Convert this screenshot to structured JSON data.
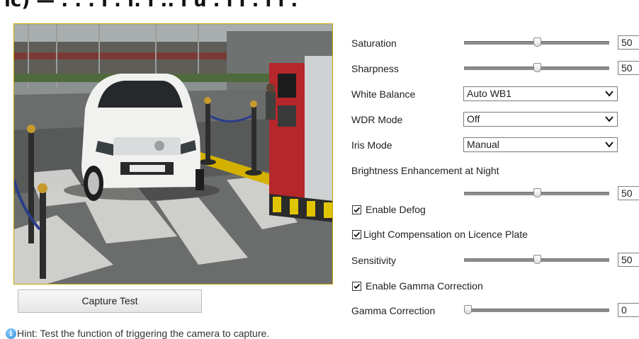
{
  "header_fragment": "ıc)  —  . . . ı . ı: ı .. ı  u .  ı  ı   .    ı ı  .",
  "preview": {
    "accent_border": "#c9a400"
  },
  "capture_test": {
    "label": "Capture Test"
  },
  "hint": {
    "icon": "info-icon",
    "text": "Hint: Test the function of triggering the camera to capture."
  },
  "settings": {
    "saturation": {
      "label": "Saturation",
      "value": "50",
      "level": 0.5
    },
    "sharpness": {
      "label": "Sharpness",
      "value": "50",
      "level": 0.5
    },
    "white_balance": {
      "label": "White Balance",
      "selected": "Auto WB1"
    },
    "wdr_mode": {
      "label": "WDR Mode",
      "selected": "Off"
    },
    "iris_mode": {
      "label": "Iris Mode",
      "selected": "Manual"
    },
    "brightness_night": {
      "label": "Brightness Enhancement at Night",
      "value": "50",
      "level": 0.5
    },
    "enable_defog": {
      "label": "Enable Defog",
      "checked": true
    },
    "light_comp": {
      "label": "Light Compensation on Licence Plate",
      "checked": true
    },
    "sensitivity": {
      "label": "Sensitivity",
      "value": "50",
      "level": 0.5
    },
    "enable_gamma": {
      "label": "Enable Gamma Correction",
      "checked": true
    },
    "gamma": {
      "label": "Gamma Correction",
      "value": "0",
      "level": 0.0
    }
  }
}
